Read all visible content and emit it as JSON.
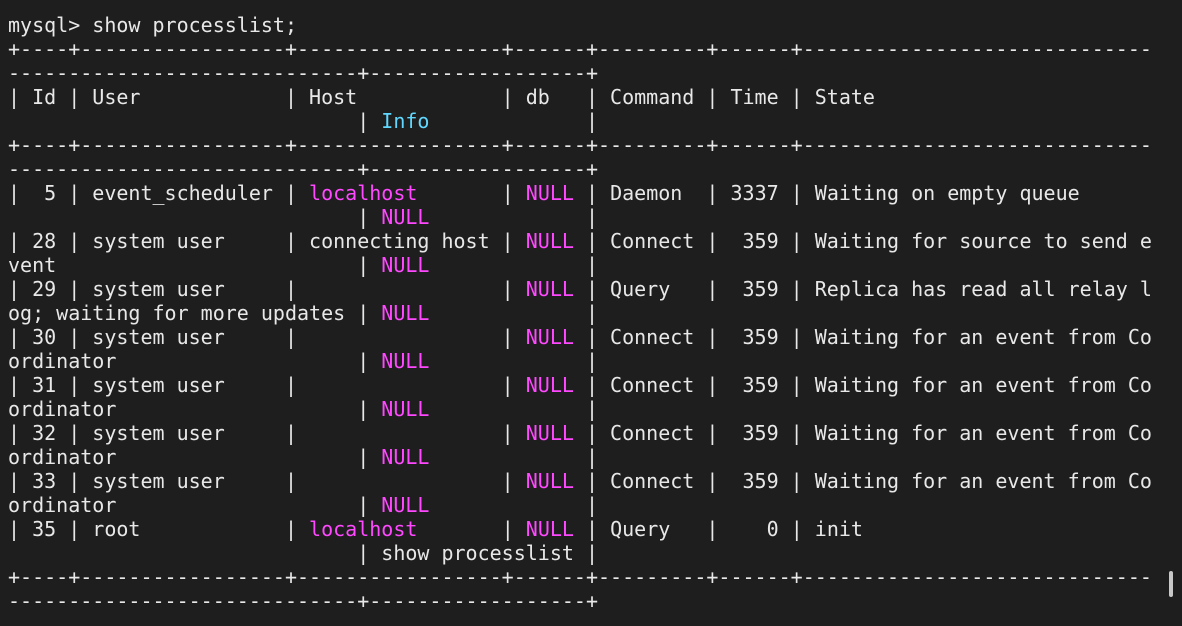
{
  "terminal": {
    "lines": [
      [
        {
          "t": "mysql> show processlist;"
        }
      ],
      [
        {
          "t": "+----+-----------------+-----------------+------+---------+------+-----------------------------"
        }
      ],
      [
        {
          "t": "-----------------------------+------------------+"
        }
      ],
      [
        {
          "t": "| Id | User            | Host            | db   | Command | Time | State"
        }
      ],
      [
        {
          "t": "                             | "
        },
        {
          "t": "Info",
          "c": "cyan"
        },
        {
          "t": "             |"
        }
      ],
      [
        {
          "t": "+----+-----------------+-----------------+------+---------+------+-----------------------------"
        }
      ],
      [
        {
          "t": "-----------------------------+------------------+"
        }
      ],
      [
        {
          "t": "|  5 | event_scheduler | "
        },
        {
          "t": "localhost",
          "c": "magenta"
        },
        {
          "t": "       | "
        },
        {
          "t": "NULL",
          "c": "magenta"
        },
        {
          "t": " | Daemon  | 3337 | Waiting on empty queue"
        }
      ],
      [
        {
          "t": "                             | "
        },
        {
          "t": "NULL",
          "c": "magenta"
        },
        {
          "t": "             |"
        }
      ],
      [
        {
          "t": "| 28 | system user     | connecting host | "
        },
        {
          "t": "NULL",
          "c": "magenta"
        },
        {
          "t": " | Connect |  359 | Waiting for source to send e"
        }
      ],
      [
        {
          "t": "vent                         | "
        },
        {
          "t": "NULL",
          "c": "magenta"
        },
        {
          "t": "             |"
        }
      ],
      [
        {
          "t": "| 29 | system user     |                 | "
        },
        {
          "t": "NULL",
          "c": "magenta"
        },
        {
          "t": " | Query   |  359 | Replica has read all relay l"
        }
      ],
      [
        {
          "t": "og; waiting for more updates | "
        },
        {
          "t": "NULL",
          "c": "magenta"
        },
        {
          "t": "             |"
        }
      ],
      [
        {
          "t": "| 30 | system user     |                 | "
        },
        {
          "t": "NULL",
          "c": "magenta"
        },
        {
          "t": " | Connect |  359 | Waiting for an event from Co"
        }
      ],
      [
        {
          "t": "ordinator                    | "
        },
        {
          "t": "NULL",
          "c": "magenta"
        },
        {
          "t": "             |"
        }
      ],
      [
        {
          "t": "| 31 | system user     |                 | "
        },
        {
          "t": "NULL",
          "c": "magenta"
        },
        {
          "t": " | Connect |  359 | Waiting for an event from Co"
        }
      ],
      [
        {
          "t": "ordinator                    | "
        },
        {
          "t": "NULL",
          "c": "magenta"
        },
        {
          "t": "             |"
        }
      ],
      [
        {
          "t": "| 32 | system user     |                 | "
        },
        {
          "t": "NULL",
          "c": "magenta"
        },
        {
          "t": " | Connect |  359 | Waiting for an event from Co"
        }
      ],
      [
        {
          "t": "ordinator                    | "
        },
        {
          "t": "NULL",
          "c": "magenta"
        },
        {
          "t": "             |"
        }
      ],
      [
        {
          "t": "| 33 | system user     |                 | "
        },
        {
          "t": "NULL",
          "c": "magenta"
        },
        {
          "t": " | Connect |  359 | Waiting for an event from Co"
        }
      ],
      [
        {
          "t": "ordinator                    | "
        },
        {
          "t": "NULL",
          "c": "magenta"
        },
        {
          "t": "             |"
        }
      ],
      [
        {
          "t": "| 35 | root            | "
        },
        {
          "t": "localhost",
          "c": "magenta"
        },
        {
          "t": "       | "
        },
        {
          "t": "NULL",
          "c": "magenta"
        },
        {
          "t": " | Query   |    0 | init"
        }
      ],
      [
        {
          "t": "                             | show processlist |"
        }
      ],
      [
        {
          "t": "+----+-----------------+-----------------+------+---------+------+-----------------------------"
        }
      ],
      [
        {
          "t": "-----------------------------+------------------+"
        }
      ]
    ]
  },
  "colors": {
    "background": "#1e1e1e",
    "text": "#e8e8e8",
    "magenta": "#ff48ff",
    "cyan": "#5fd7ff",
    "scrollbar_thumb": "#c8c8c8"
  }
}
